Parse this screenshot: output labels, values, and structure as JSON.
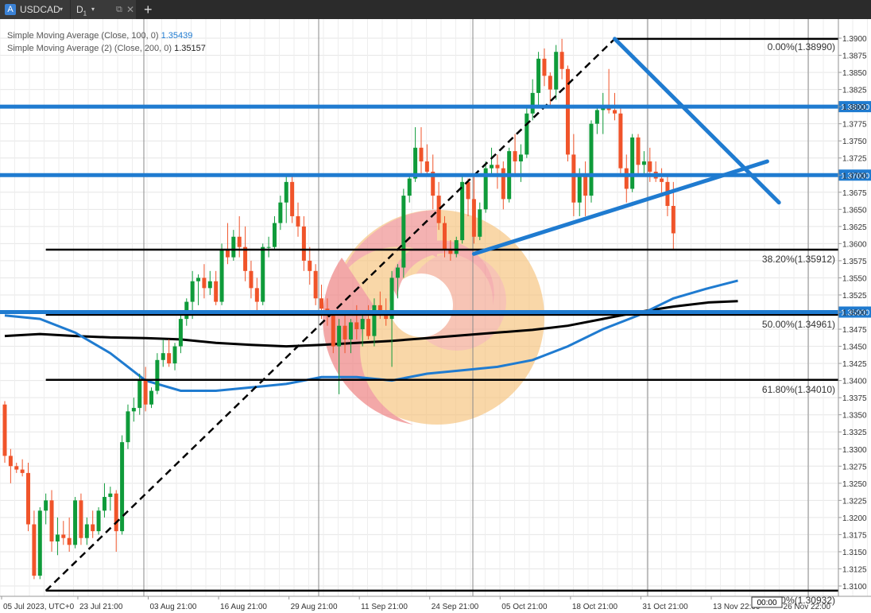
{
  "tabs": [
    {
      "badge": "A",
      "label": "USDCAD",
      "arrow": "▾"
    },
    {
      "timeframe": "D",
      "sub": "1",
      "arrow": "▾",
      "detach": "⧉",
      "close": "✕"
    }
  ],
  "new_tab": "+",
  "indicators": [
    {
      "name": "Simple Moving Average (Close, 100, 0)",
      "value": "1.35439"
    },
    {
      "name": "Simple Moving Average (2) (Close, 200, 0)",
      "value": "1.35157"
    }
  ],
  "colors": {
    "bull": "#0f9b3a",
    "bear": "#f0542a",
    "blue": "#1f7bd0",
    "black": "#000000"
  },
  "chart_data": {
    "type": "candlestick",
    "symbol": "USDCAD",
    "timeframe": "D1",
    "ylim": [
      1.3085,
      1.3915
    ],
    "y_ticks": [
      "1.3900",
      "1.3875",
      "1.3850",
      "1.3825",
      "1.3800",
      "1.3775",
      "1.3750",
      "1.3725",
      "1.3700",
      "1.3675",
      "1.3650",
      "1.3625",
      "1.3600",
      "1.3575",
      "1.3550",
      "1.3525",
      "1.3500",
      "1.3475",
      "1.3450",
      "1.3425",
      "1.3400",
      "1.3375",
      "1.3350",
      "1.3325",
      "1.3300",
      "1.3275",
      "1.3250",
      "1.3225",
      "1.3200",
      "1.3175",
      "1.3150",
      "1.3125",
      "1.3100"
    ],
    "x_labels": [
      "05 Jul 2023, UTC+0",
      "23 Jul 21:00",
      "03 Aug 21:00",
      "16 Aug 21:00",
      "29 Aug 21:00",
      "11 Sep 21:00",
      "24 Sep 21:00",
      "05 Oct 21:00",
      "18 Oct 21:00",
      "31 Oct 21:00",
      "13 Nov 22:00",
      "26 Nov 22:00"
    ],
    "x_label_bar": [
      0,
      13,
      25,
      37,
      49,
      61,
      73,
      85,
      97,
      109,
      121,
      133
    ],
    "grid": true,
    "candles": [
      {
        "o": 1.3365,
        "h": 1.337,
        "l": 1.328,
        "c": 1.329
      },
      {
        "o": 1.329,
        "h": 1.33,
        "l": 1.325,
        "c": 1.3275
      },
      {
        "o": 1.3275,
        "h": 1.328,
        "l": 1.3265,
        "c": 1.327
      },
      {
        "o": 1.327,
        "h": 1.3285,
        "l": 1.326,
        "c": 1.3265
      },
      {
        "o": 1.3265,
        "h": 1.328,
        "l": 1.318,
        "c": 1.319
      },
      {
        "o": 1.319,
        "h": 1.321,
        "l": 1.311,
        "c": 1.3115
      },
      {
        "o": 1.3115,
        "h": 1.3215,
        "l": 1.311,
        "c": 1.321
      },
      {
        "o": 1.321,
        "h": 1.3235,
        "l": 1.319,
        "c": 1.3225
      },
      {
        "o": 1.3225,
        "h": 1.324,
        "l": 1.315,
        "c": 1.3165
      },
      {
        "o": 1.3165,
        "h": 1.32,
        "l": 1.3145,
        "c": 1.3175
      },
      {
        "o": 1.3175,
        "h": 1.3195,
        "l": 1.316,
        "c": 1.317
      },
      {
        "o": 1.317,
        "h": 1.32,
        "l": 1.315,
        "c": 1.316
      },
      {
        "o": 1.316,
        "h": 1.323,
        "l": 1.3155,
        "c": 1.3225
      },
      {
        "o": 1.3225,
        "h": 1.3235,
        "l": 1.316,
        "c": 1.317
      },
      {
        "o": 1.317,
        "h": 1.32,
        "l": 1.316,
        "c": 1.319
      },
      {
        "o": 1.319,
        "h": 1.321,
        "l": 1.317,
        "c": 1.318
      },
      {
        "o": 1.318,
        "h": 1.3215,
        "l": 1.3175,
        "c": 1.321
      },
      {
        "o": 1.321,
        "h": 1.325,
        "l": 1.32,
        "c": 1.323
      },
      {
        "o": 1.323,
        "h": 1.3245,
        "l": 1.321,
        "c": 1.3235
      },
      {
        "o": 1.3235,
        "h": 1.324,
        "l": 1.315,
        "c": 1.318
      },
      {
        "o": 1.318,
        "h": 1.332,
        "l": 1.3175,
        "c": 1.331
      },
      {
        "o": 1.331,
        "h": 1.3365,
        "l": 1.33,
        "c": 1.3355
      },
      {
        "o": 1.3355,
        "h": 1.3375,
        "l": 1.334,
        "c": 1.336
      },
      {
        "o": 1.336,
        "h": 1.341,
        "l": 1.335,
        "c": 1.34
      },
      {
        "o": 1.34,
        "h": 1.342,
        "l": 1.3355,
        "c": 1.3365
      },
      {
        "o": 1.3365,
        "h": 1.339,
        "l": 1.336,
        "c": 1.3385
      },
      {
        "o": 1.3385,
        "h": 1.344,
        "l": 1.338,
        "c": 1.343
      },
      {
        "o": 1.343,
        "h": 1.346,
        "l": 1.342,
        "c": 1.344
      },
      {
        "o": 1.344,
        "h": 1.346,
        "l": 1.342,
        "c": 1.3425
      },
      {
        "o": 1.3425,
        "h": 1.3455,
        "l": 1.3415,
        "c": 1.345
      },
      {
        "o": 1.345,
        "h": 1.35,
        "l": 1.344,
        "c": 1.349
      },
      {
        "o": 1.349,
        "h": 1.352,
        "l": 1.348,
        "c": 1.3515
      },
      {
        "o": 1.3515,
        "h": 1.356,
        "l": 1.349,
        "c": 1.3545
      },
      {
        "o": 1.3545,
        "h": 1.3555,
        "l": 1.351,
        "c": 1.355
      },
      {
        "o": 1.355,
        "h": 1.357,
        "l": 1.352,
        "c": 1.3535
      },
      {
        "o": 1.3535,
        "h": 1.356,
        "l": 1.3525,
        "c": 1.3545
      },
      {
        "o": 1.3545,
        "h": 1.356,
        "l": 1.351,
        "c": 1.3515
      },
      {
        "o": 1.3515,
        "h": 1.36,
        "l": 1.351,
        "c": 1.359
      },
      {
        "o": 1.359,
        "h": 1.363,
        "l": 1.357,
        "c": 1.358
      },
      {
        "o": 1.358,
        "h": 1.362,
        "l": 1.3575,
        "c": 1.361
      },
      {
        "o": 1.361,
        "h": 1.364,
        "l": 1.358,
        "c": 1.3595
      },
      {
        "o": 1.3595,
        "h": 1.3625,
        "l": 1.3545,
        "c": 1.356
      },
      {
        "o": 1.356,
        "h": 1.3575,
        "l": 1.352,
        "c": 1.3535
      },
      {
        "o": 1.3535,
        "h": 1.355,
        "l": 1.35,
        "c": 1.3515
      },
      {
        "o": 1.3515,
        "h": 1.36,
        "l": 1.351,
        "c": 1.3595
      },
      {
        "o": 1.3595,
        "h": 1.361,
        "l": 1.358,
        "c": 1.3595
      },
      {
        "o": 1.3595,
        "h": 1.364,
        "l": 1.359,
        "c": 1.363
      },
      {
        "o": 1.363,
        "h": 1.367,
        "l": 1.362,
        "c": 1.366
      },
      {
        "o": 1.366,
        "h": 1.37,
        "l": 1.363,
        "c": 1.369
      },
      {
        "o": 1.369,
        "h": 1.37,
        "l": 1.363,
        "c": 1.364
      },
      {
        "o": 1.364,
        "h": 1.366,
        "l": 1.361,
        "c": 1.3625
      },
      {
        "o": 1.3625,
        "h": 1.364,
        "l": 1.356,
        "c": 1.3575
      },
      {
        "o": 1.3575,
        "h": 1.3595,
        "l": 1.354,
        "c": 1.356
      },
      {
        "o": 1.356,
        "h": 1.357,
        "l": 1.351,
        "c": 1.352
      },
      {
        "o": 1.352,
        "h": 1.354,
        "l": 1.349,
        "c": 1.3505
      },
      {
        "o": 1.3505,
        "h": 1.352,
        "l": 1.348,
        "c": 1.3495
      },
      {
        "o": 1.3495,
        "h": 1.35,
        "l": 1.344,
        "c": 1.345
      },
      {
        "o": 1.345,
        "h": 1.349,
        "l": 1.338,
        "c": 1.348
      },
      {
        "o": 1.348,
        "h": 1.35,
        "l": 1.344,
        "c": 1.346
      },
      {
        "o": 1.346,
        "h": 1.349,
        "l": 1.344,
        "c": 1.3485
      },
      {
        "o": 1.3485,
        "h": 1.351,
        "l": 1.346,
        "c": 1.3475
      },
      {
        "o": 1.3475,
        "h": 1.3495,
        "l": 1.345,
        "c": 1.349
      },
      {
        "o": 1.349,
        "h": 1.351,
        "l": 1.346,
        "c": 1.3465
      },
      {
        "o": 1.3465,
        "h": 1.352,
        "l": 1.345,
        "c": 1.351
      },
      {
        "o": 1.351,
        "h": 1.353,
        "l": 1.349,
        "c": 1.35
      },
      {
        "o": 1.35,
        "h": 1.352,
        "l": 1.348,
        "c": 1.349
      },
      {
        "o": 1.349,
        "h": 1.356,
        "l": 1.342,
        "c": 1.355
      },
      {
        "o": 1.355,
        "h": 1.357,
        "l": 1.352,
        "c": 1.3565
      },
      {
        "o": 1.3565,
        "h": 1.368,
        "l": 1.355,
        "c": 1.367
      },
      {
        "o": 1.367,
        "h": 1.37,
        "l": 1.366,
        "c": 1.3695
      },
      {
        "o": 1.3695,
        "h": 1.377,
        "l": 1.369,
        "c": 1.374
      },
      {
        "o": 1.374,
        "h": 1.377,
        "l": 1.37,
        "c": 1.372
      },
      {
        "o": 1.372,
        "h": 1.3745,
        "l": 1.37,
        "c": 1.3705
      },
      {
        "o": 1.3705,
        "h": 1.373,
        "l": 1.365,
        "c": 1.367
      },
      {
        "o": 1.367,
        "h": 1.369,
        "l": 1.362,
        "c": 1.363
      },
      {
        "o": 1.363,
        "h": 1.364,
        "l": 1.358,
        "c": 1.359
      },
      {
        "o": 1.359,
        "h": 1.3605,
        "l": 1.3575,
        "c": 1.3585
      },
      {
        "o": 1.3585,
        "h": 1.361,
        "l": 1.358,
        "c": 1.3605
      },
      {
        "o": 1.3605,
        "h": 1.37,
        "l": 1.36,
        "c": 1.369
      },
      {
        "o": 1.369,
        "h": 1.3695,
        "l": 1.364,
        "c": 1.3665
      },
      {
        "o": 1.3665,
        "h": 1.37,
        "l": 1.36,
        "c": 1.361
      },
      {
        "o": 1.361,
        "h": 1.366,
        "l": 1.3605,
        "c": 1.365
      },
      {
        "o": 1.365,
        "h": 1.372,
        "l": 1.3645,
        "c": 1.371
      },
      {
        "o": 1.371,
        "h": 1.374,
        "l": 1.37,
        "c": 1.3715
      },
      {
        "o": 1.3715,
        "h": 1.373,
        "l": 1.368,
        "c": 1.371
      },
      {
        "o": 1.371,
        "h": 1.372,
        "l": 1.365,
        "c": 1.3665
      },
      {
        "o": 1.3665,
        "h": 1.374,
        "l": 1.366,
        "c": 1.3735
      },
      {
        "o": 1.3735,
        "h": 1.376,
        "l": 1.37,
        "c": 1.372
      },
      {
        "o": 1.372,
        "h": 1.3745,
        "l": 1.369,
        "c": 1.373
      },
      {
        "o": 1.373,
        "h": 1.38,
        "l": 1.3725,
        "c": 1.379
      },
      {
        "o": 1.379,
        "h": 1.384,
        "l": 1.378,
        "c": 1.382
      },
      {
        "o": 1.382,
        "h": 1.388,
        "l": 1.38,
        "c": 1.387
      },
      {
        "o": 1.387,
        "h": 1.3885,
        "l": 1.383,
        "c": 1.3845
      },
      {
        "o": 1.3845,
        "h": 1.385,
        "l": 1.38,
        "c": 1.3825
      },
      {
        "o": 1.3825,
        "h": 1.389,
        "l": 1.381,
        "c": 1.388
      },
      {
        "o": 1.388,
        "h": 1.3899,
        "l": 1.384,
        "c": 1.3855
      },
      {
        "o": 1.3855,
        "h": 1.386,
        "l": 1.372,
        "c": 1.373
      },
      {
        "o": 1.373,
        "h": 1.376,
        "l": 1.364,
        "c": 1.366
      },
      {
        "o": 1.366,
        "h": 1.371,
        "l": 1.364,
        "c": 1.37
      },
      {
        "o": 1.37,
        "h": 1.372,
        "l": 1.364,
        "c": 1.367
      },
      {
        "o": 1.367,
        "h": 1.378,
        "l": 1.366,
        "c": 1.3775
      },
      {
        "o": 1.3775,
        "h": 1.38,
        "l": 1.376,
        "c": 1.3795
      },
      {
        "o": 1.3795,
        "h": 1.382,
        "l": 1.376,
        "c": 1.38
      },
      {
        "o": 1.38,
        "h": 1.3855,
        "l": 1.379,
        "c": 1.3795
      },
      {
        "o": 1.3795,
        "h": 1.382,
        "l": 1.378,
        "c": 1.379
      },
      {
        "o": 1.379,
        "h": 1.38,
        "l": 1.37,
        "c": 1.371
      },
      {
        "o": 1.371,
        "h": 1.373,
        "l": 1.366,
        "c": 1.368
      },
      {
        "o": 1.368,
        "h": 1.376,
        "l": 1.3675,
        "c": 1.3755
      },
      {
        "o": 1.3755,
        "h": 1.376,
        "l": 1.37,
        "c": 1.3715
      },
      {
        "o": 1.3715,
        "h": 1.3735,
        "l": 1.37,
        "c": 1.372
      },
      {
        "o": 1.372,
        "h": 1.374,
        "l": 1.369,
        "c": 1.3705
      },
      {
        "o": 1.3705,
        "h": 1.372,
        "l": 1.369,
        "c": 1.3695
      },
      {
        "o": 1.3695,
        "h": 1.371,
        "l": 1.367,
        "c": 1.369
      },
      {
        "o": 1.369,
        "h": 1.37,
        "l": 1.364,
        "c": 1.3655
      },
      {
        "o": 1.3655,
        "h": 1.369,
        "l": 1.359,
        "c": 1.3615
      }
    ],
    "sma100": [
      [
        0,
        1.3495
      ],
      [
        6,
        1.349
      ],
      [
        12,
        1.347
      ],
      [
        18,
        1.344
      ],
      [
        24,
        1.34
      ],
      [
        30,
        1.3385
      ],
      [
        36,
        1.3385
      ],
      [
        42,
        1.339
      ],
      [
        48,
        1.3395
      ],
      [
        54,
        1.3405
      ],
      [
        60,
        1.3405
      ],
      [
        66,
        1.34
      ],
      [
        72,
        1.341
      ],
      [
        78,
        1.3415
      ],
      [
        84,
        1.342
      ],
      [
        90,
        1.343
      ],
      [
        96,
        1.345
      ],
      [
        102,
        1.3475
      ],
      [
        108,
        1.3495
      ],
      [
        114,
        1.352
      ],
      [
        120,
        1.3535
      ],
      [
        125,
        1.3546
      ]
    ],
    "sma200": [
      [
        0,
        1.3465
      ],
      [
        6,
        1.3468
      ],
      [
        12,
        1.3465
      ],
      [
        18,
        1.3463
      ],
      [
        24,
        1.3462
      ],
      [
        30,
        1.346
      ],
      [
        36,
        1.3455
      ],
      [
        42,
        1.3452
      ],
      [
        48,
        1.345
      ],
      [
        54,
        1.3452
      ],
      [
        60,
        1.3455
      ],
      [
        66,
        1.3458
      ],
      [
        72,
        1.3462
      ],
      [
        78,
        1.3466
      ],
      [
        84,
        1.347
      ],
      [
        90,
        1.3474
      ],
      [
        96,
        1.348
      ],
      [
        102,
        1.349
      ],
      [
        108,
        1.35
      ],
      [
        114,
        1.3508
      ],
      [
        120,
        1.3514
      ],
      [
        125,
        1.3516
      ]
    ],
    "horizontal_levels": [
      {
        "price": 1.38,
        "label": "1.38000"
      },
      {
        "price": 1.37,
        "label": "1.37000"
      },
      {
        "price": 1.35,
        "label": "1.35000"
      }
    ],
    "fibonacci": {
      "from": {
        "bar": 7,
        "price": 1.3093
      },
      "to": {
        "bar": 104,
        "price": 1.3899
      },
      "levels": [
        {
          "label": "0.00%(1.38990)",
          "price": 1.3899,
          "start_bar": 104
        },
        {
          "label": "38.20%(1.35912)",
          "price": 1.35912,
          "start_bar": 7
        },
        {
          "label": "50.00%(1.34961)",
          "price": 1.34961,
          "start_bar": 7
        },
        {
          "label": "61.80%(1.34010)",
          "price": 1.3401,
          "start_bar": 7
        },
        {
          "label": "100.00%(1.30932)",
          "price": 1.30932,
          "start_bar": 7
        }
      ]
    },
    "trendlines": [
      {
        "from": {
          "bar": 80,
          "price": 1.3585
        },
        "to": {
          "bar": 130,
          "price": 1.372
        }
      },
      {
        "from": {
          "bar": 104,
          "price": 1.3899
        },
        "to": {
          "bar": 132,
          "price": 1.366
        }
      }
    ],
    "time_readout": "00:00"
  }
}
